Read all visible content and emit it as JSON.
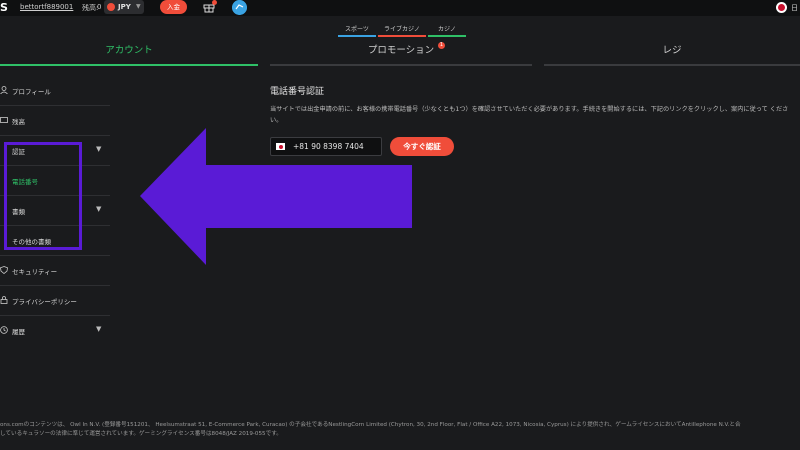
{
  "header": {
    "logo": "S",
    "username": "bettortf889001",
    "balance_label": "残高:",
    "balance_value": "0",
    "currency": "JPY",
    "deposit_label": "入金",
    "lang": "日"
  },
  "product_nav": [
    {
      "label": "スポーツ",
      "color": "#3aa3e3"
    },
    {
      "label": "ライブカジノ",
      "color": "#f04d3a"
    },
    {
      "label": "カジノ",
      "color": "#2fc067"
    }
  ],
  "tabs": [
    {
      "label": "アカウント",
      "active": true
    },
    {
      "label": "プロモーション",
      "badge": "1",
      "active": false
    },
    {
      "label": "レジ",
      "active": false
    }
  ],
  "sidebar": {
    "items": [
      {
        "label": "プロフィール",
        "icon": "user-icon"
      },
      {
        "label": "残高",
        "icon": "wallet-icon"
      },
      {
        "label": "認証",
        "caret": "▼"
      },
      {
        "label": "電話番号",
        "active": true
      },
      {
        "label": "書類",
        "caret": "▼"
      },
      {
        "label": "その他の書類"
      },
      {
        "label": "セキュリティー",
        "icon": "shield-icon"
      },
      {
        "label": "プライバシーポリシー",
        "icon": "lock-icon"
      },
      {
        "label": "履歴",
        "icon": "clock-icon",
        "caret": "▼"
      }
    ]
  },
  "content": {
    "title": "電話番号認証",
    "description": "当サイトでは出金申請の前に、お客様の携帯電話番号（少なくとも1つ）を確認させていただく必要があります。手続きを開始するには、下記のリンクをクリックし、案内に従って ください。",
    "phone_value": "+81 90 8398 7404",
    "verify_label": "今すぐ認証"
  },
  "footer": {
    "line1": "ons.comのコンテンツは、 Owl In N.V. (登録番号151201、 Heelsumstraat 51, E-Commerce Park, Curacao) の子会社であるNestlingCorn Limited (Chytron, 30, 2nd Floor, Flat / Office A22, 1073, Nicosia, Cyprus) により提供され、ゲームライセンスにおいてAntillephone N.V.と合",
    "line2": "しているキュラソーの法律に準じて運営されています。ゲーミングライセンス番号は8048/JAZ 2019-055です。"
  },
  "colors": {
    "accent_green": "#2fc067",
    "accent_red": "#f04d3a",
    "highlight_purple": "#5a1bd6"
  }
}
